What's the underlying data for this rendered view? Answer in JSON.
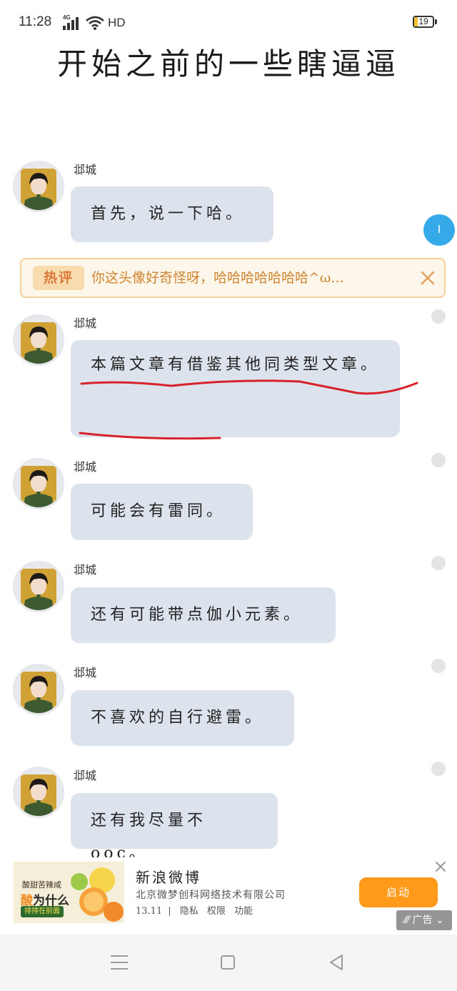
{
  "status_bar": {
    "time": "11:28",
    "network": "4G",
    "hd": "HD",
    "battery": "19",
    "battery_level": 0.19
  },
  "title": "开始之前的一些瞎逼逼",
  "float_button": {
    "label": "I"
  },
  "hot_comment": {
    "tag": "热评",
    "text": "你这头像好奇怪呀，哈哈哈哈哈哈哈^ω..."
  },
  "messages": [
    {
      "sender": "邶城",
      "text": "首先，说一下哈。"
    },
    {
      "sender": "邶城",
      "text": "本篇文章有借鉴其他同类型文章。"
    },
    {
      "sender": "邶城",
      "text": "可能会有雷同。"
    },
    {
      "sender": "邶城",
      "text": "还有可能带点伽小元素。"
    },
    {
      "sender": "邶城",
      "text": "不喜欢的自行避雷。"
    },
    {
      "sender": "邶城",
      "text": "还有我尽量不ooc。"
    }
  ],
  "ad": {
    "image_title": "酸甜苦辣咸",
    "image_main_accent": "酸",
    "image_main_rest": "为什么",
    "image_sub": "排排在前面",
    "title": "新浪微博",
    "company": "北京微梦创科网络技术有限公司",
    "version": "13.11",
    "links": [
      "隐私",
      "权限",
      "功能"
    ],
    "button": "启动",
    "badge": "广告"
  },
  "colors": {
    "bubble": "#dde3ec",
    "hot_border": "#f5cf98",
    "hot_text": "#d0832e",
    "ad_button": "#ff9a1a",
    "float_button": "#36a9e8",
    "annotation_line": "#d8222a"
  }
}
